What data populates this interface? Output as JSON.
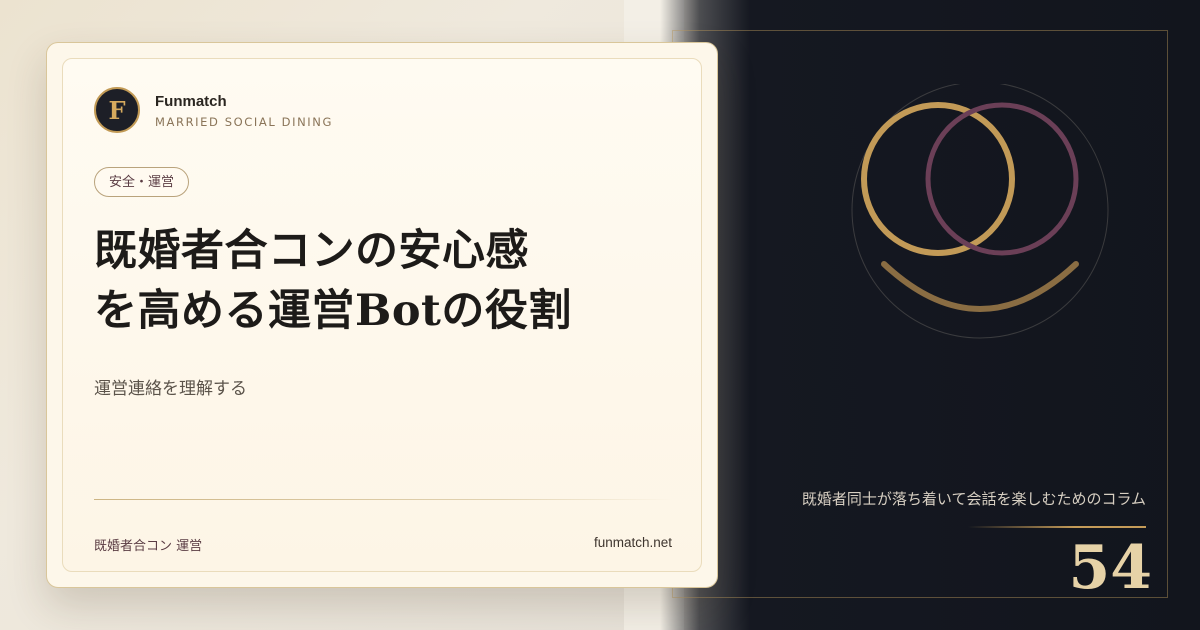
{
  "brand": {
    "logo_letter": "F",
    "name": "Funmatch",
    "tagline": "MARRIED SOCIAL DINING"
  },
  "category": "安全・運営",
  "title": {
    "line1": "既婚者合コンの安心感",
    "line2": "を高める運営Botの役割"
  },
  "subtitle": "運営連絡を理解する",
  "footer": {
    "left": "既婚者合コン 運営",
    "right": "funmatch.net"
  },
  "side": {
    "caption": "既婚者同士が落ち着いて会話を楽しむためのコラム",
    "number": "54"
  },
  "colors": {
    "accent_gold": "#c49b58",
    "accent_plum": "#6b3f57",
    "dark_bg": "#151821",
    "card_bg": "#fdf7ea",
    "text_dark": "#1d1b19"
  },
  "icons": [
    "interlocking-rings-icon"
  ]
}
